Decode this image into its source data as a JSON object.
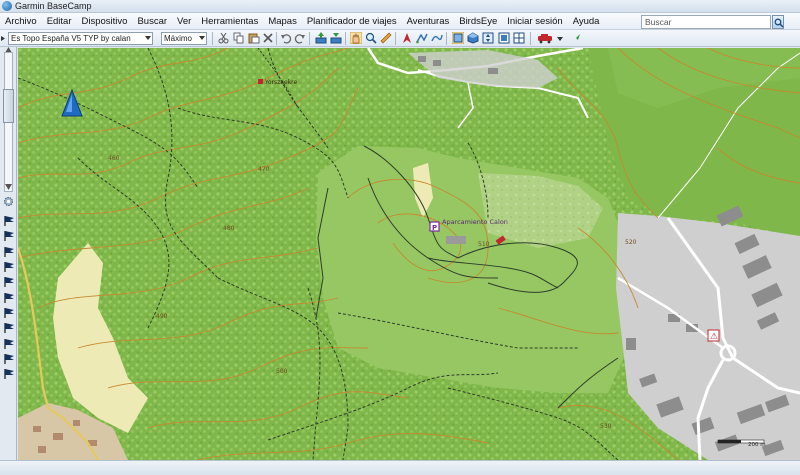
{
  "window": {
    "title": "Garmin BaseCamp"
  },
  "menu": {
    "items": [
      "Archivo",
      "Editar",
      "Dispositivo",
      "Buscar",
      "Ver",
      "Herramientas",
      "Mapas",
      "Planificador de viajes",
      "Aventuras",
      "BirdsEye",
      "Iniciar sesión",
      "Ayuda"
    ]
  },
  "search": {
    "placeholder": "Buscar"
  },
  "toolbar": {
    "map_product": "Es Topo España V5 TYP by calan",
    "detail_level": "Máximo"
  },
  "map": {
    "labels": {
      "place_top": "Yorszaekre",
      "parking": "Aparcamiento Calon",
      "scale": "200 m"
    },
    "contours": [
      "460",
      "470",
      "480",
      "490",
      "500",
      "510",
      "520",
      "530"
    ],
    "colors": {
      "forest": "#7fb74a",
      "forest_texture": "#9bcd67",
      "meadow": "#96c763",
      "clearing": "#b1d285",
      "scrub": "#eeeab6",
      "urban": "#cfcfcf",
      "building": "#8d8d8d",
      "contour": "#c58a2f",
      "track": "#2e3d2a",
      "road_white": "#ffffff"
    }
  }
}
